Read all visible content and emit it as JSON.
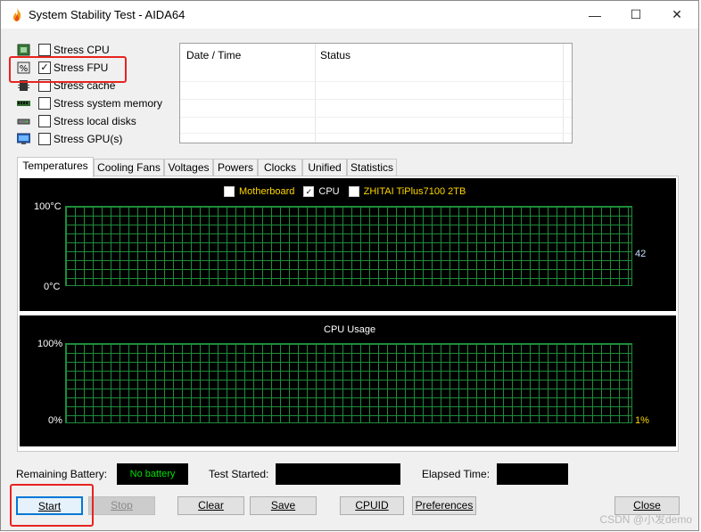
{
  "window": {
    "title": "System Stability Test - AIDA64",
    "controls": {
      "minimize": "—",
      "maximize": "☐",
      "close": "✕"
    }
  },
  "options": [
    {
      "label": "Stress CPU",
      "checked": false,
      "icon": "cpu-chip-icon"
    },
    {
      "label": "Stress FPU",
      "checked": true,
      "icon": "fpu-percent-icon"
    },
    {
      "label": "Stress cache",
      "checked": false,
      "icon": "cache-chip-icon"
    },
    {
      "label": "Stress system memory",
      "checked": false,
      "icon": "memory-module-icon"
    },
    {
      "label": "Stress local disks",
      "checked": false,
      "icon": "disk-drive-icon"
    },
    {
      "label": "Stress GPU(s)",
      "checked": false,
      "icon": "monitor-icon"
    }
  ],
  "log": {
    "columns": [
      "Date / Time",
      "Status"
    ],
    "rows": []
  },
  "tabs": [
    {
      "label": "Temperatures",
      "active": true
    },
    {
      "label": "Cooling Fans",
      "active": false
    },
    {
      "label": "Voltages",
      "active": false
    },
    {
      "label": "Powers",
      "active": false
    },
    {
      "label": "Clocks",
      "active": false
    },
    {
      "label": "Unified",
      "active": false
    },
    {
      "label": "Statistics",
      "active": false
    }
  ],
  "temp_graph": {
    "legend": [
      {
        "label": "Motherboard",
        "checked": false,
        "color": "#ffd700"
      },
      {
        "label": "CPU",
        "checked": true,
        "color": "#ffffff"
      },
      {
        "label": "ZHITAI TiPlus7100 2TB",
        "checked": false,
        "color": "#ffd700"
      }
    ],
    "y_max": "100°C",
    "y_min": "0°C",
    "current_value": "42",
    "value_color": "#c8e0ff",
    "grid_color": "#1e8c3a"
  },
  "cpu_graph": {
    "title": "CPU Usage",
    "y_max": "100%",
    "y_min": "0%",
    "current_value": "1%",
    "value_color": "#ffd700",
    "grid_color": "#1e8c3a"
  },
  "status": {
    "battery_label": "Remaining Battery:",
    "battery_value": "No battery",
    "battery_color": "#00e000",
    "started_label": "Test Started:",
    "started_value": "",
    "elapsed_label": "Elapsed Time:",
    "elapsed_value": ""
  },
  "buttons": {
    "start": "Start",
    "stop": "Stop",
    "clear": "Clear",
    "save": "Save",
    "cpuid": "CPUID",
    "preferences": "Preferences",
    "close": "Close"
  },
  "watermark": "CSDN @小发demo",
  "highlight_color": "#e8231f"
}
